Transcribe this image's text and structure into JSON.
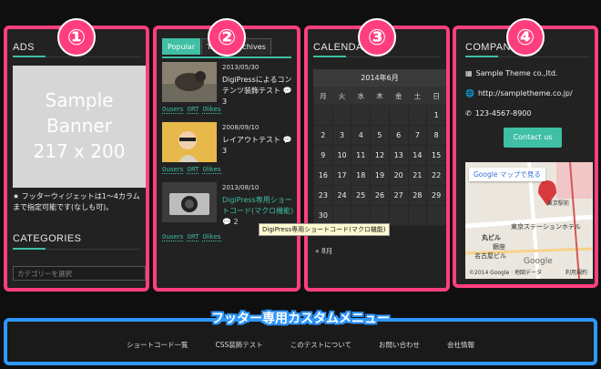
{
  "panels": {
    "p1": {
      "num": "①",
      "ads_title": "ADS",
      "banner_line1": "Sample",
      "banner_line2": "Banner",
      "banner_line3": "217 x 200",
      "ads_note": "★ フッターウィジェットは1〜4カラムまで指定可能です(なしも可)。",
      "categories_title": "CATEGORIES",
      "category_select_placeholder": "カテゴリーを選択"
    },
    "p2": {
      "num": "②",
      "tabs": [
        {
          "label": "Popular"
        },
        {
          "label": "Tags"
        },
        {
          "label": "Archives"
        }
      ],
      "posts": [
        {
          "date": "2013/05/30",
          "title": "DigiPressによるコンテンツ装飾テスト",
          "comments": "3",
          "tags": [
            "0users",
            "0RT",
            "0likes"
          ]
        },
        {
          "date": "2008/09/10",
          "title": "レイアウトテスト",
          "comments": "3",
          "tags": [
            "0users",
            "0RT",
            "0likes"
          ]
        },
        {
          "date": "2013/08/10",
          "title": "DigiPress専用ショートコード(マクロ機能)",
          "comments": "2",
          "tags": [
            "0users",
            "0RT",
            "0likes"
          ]
        }
      ],
      "tooltip": "DigiPress専用ショートコード(マクロ機能)"
    },
    "p3": {
      "num": "③",
      "title": "CALENDAR",
      "caption": "2014年6月",
      "weekdays": [
        "月",
        "火",
        "水",
        "木",
        "金",
        "土",
        "日"
      ],
      "weeks": [
        [
          "",
          "",
          "",
          "",
          "",
          "",
          "1"
        ],
        [
          "2",
          "3",
          "4",
          "5",
          "6",
          "7",
          "8"
        ],
        [
          "9",
          "10",
          "11",
          "12",
          "13",
          "14",
          "15"
        ],
        [
          "16",
          "17",
          "18",
          "19",
          "20",
          "21",
          "22"
        ],
        [
          "23",
          "24",
          "25",
          "26",
          "27",
          "28",
          "29"
        ],
        [
          "30",
          "",
          "",
          "",
          "",
          "",
          ""
        ]
      ],
      "footer": "« 8月"
    },
    "p4": {
      "num": "④",
      "title": "COMPANY",
      "name": "Sample Theme co.,ltd.",
      "url": "http://sampletheme.co.jp/",
      "phone": "123-4567-8900",
      "contact_label": "Contact us",
      "map_link": "Google マップで見る",
      "map_labels": {
        "station": "東京ステーションホテル",
        "marunouchi": "丸ビル",
        "ginza": "銀座",
        "nagoya": "名古屋ビル",
        "copyright": "©2014 Google · 地図データ",
        "terms": "利用規約",
        "google": "Google",
        "top": "東京駅前"
      }
    }
  },
  "footer_menu": {
    "title": "フッター専用カスタムメニュー",
    "items": [
      {
        "label": "ショートコード一覧"
      },
      {
        "label": "CSS装飾テスト"
      },
      {
        "label": "このテストについて"
      },
      {
        "label": "お問い合わせ"
      },
      {
        "label": "会社情報"
      }
    ]
  },
  "colors": {
    "accent": "#3fbfa4",
    "highlight": "#ff3f7d",
    "footer_highlight": "#2f97ff"
  }
}
